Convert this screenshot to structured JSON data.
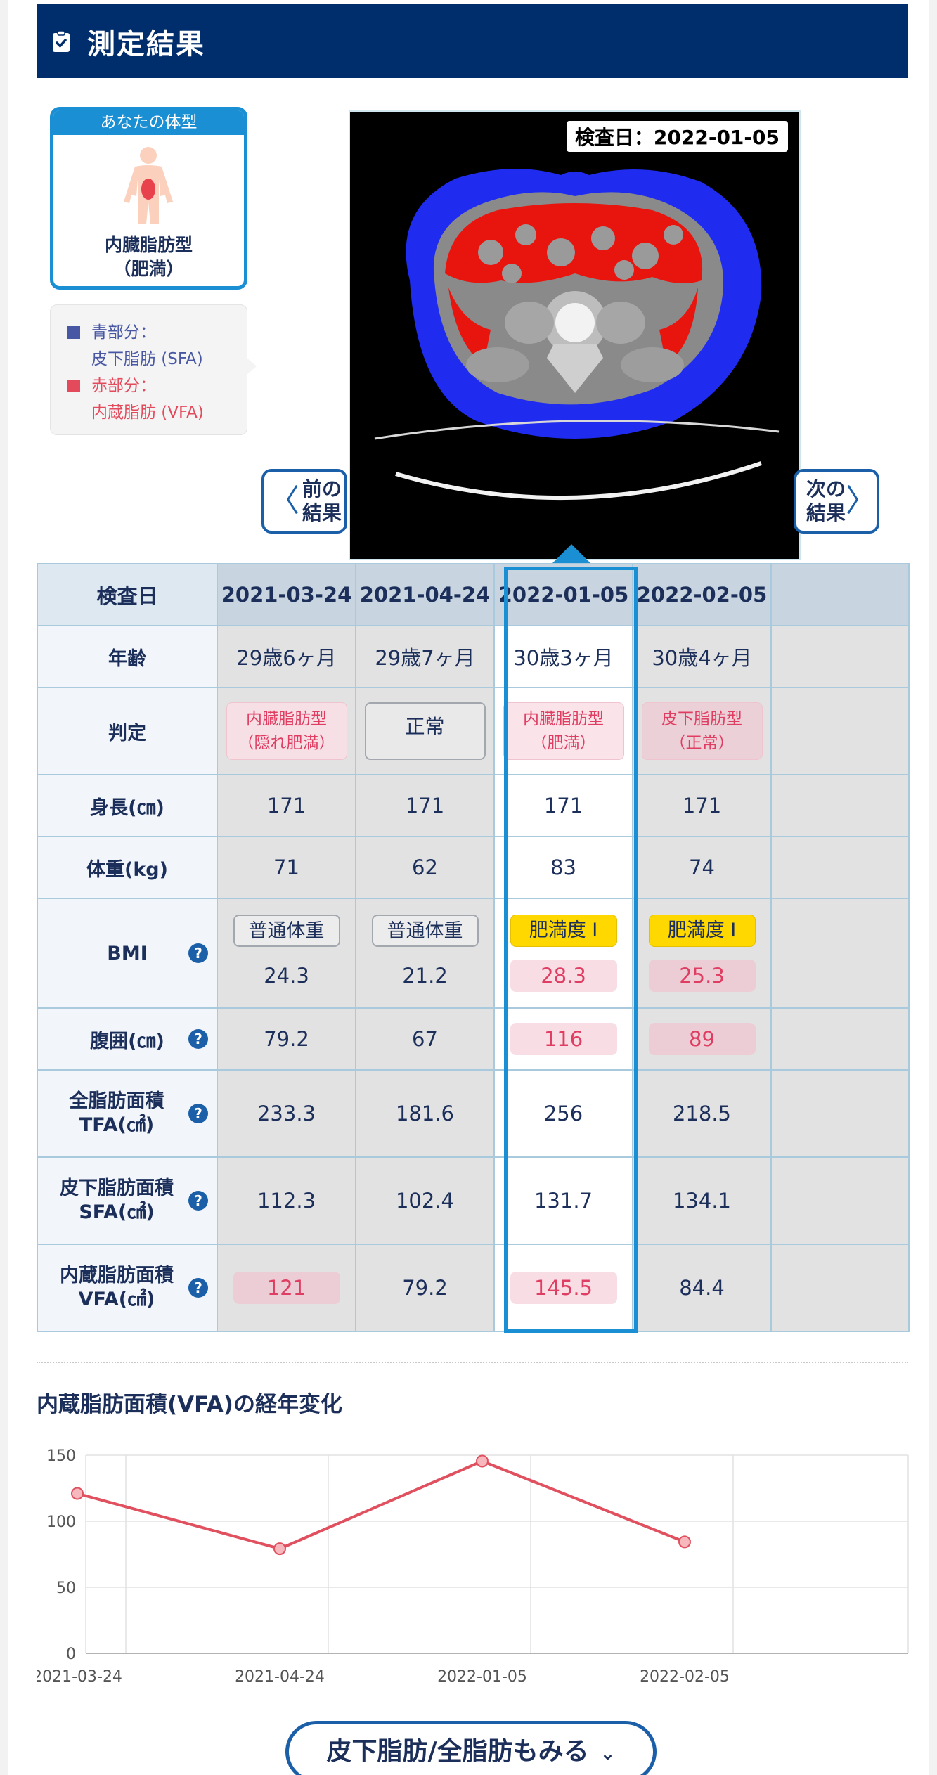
{
  "header": {
    "title": "測定結果",
    "icon": "clipboard-check-icon"
  },
  "body_type": {
    "heading": "あなたの体型",
    "type_line1": "内臓脂肪型",
    "type_line2": "（肥満）",
    "icon": "body-figure-icon"
  },
  "legend": {
    "blue_label": "青部分：",
    "blue_desc": "皮下脂肪 (SFA)",
    "red_label": "赤部分：",
    "red_desc": "内蔵脂肪 (VFA)",
    "blue_color": "#4757a3",
    "red_color": "#e34a5c"
  },
  "ct": {
    "date_label": "検査日：2022-01-05"
  },
  "nav": {
    "prev_line1": "前の",
    "prev_line2": "結果",
    "next_line1": "次の",
    "next_line2": "結果"
  },
  "table": {
    "row_headers": {
      "date": "検査日",
      "age": "年齢",
      "judgement": "判定",
      "height": "身長(㎝)",
      "weight": "体重(kg)",
      "bmi": "BMI",
      "waist": "腹囲(㎝)",
      "tfa1": "全脂肪面積",
      "tfa2": "TFA(㎠)",
      "sfa1": "皮下脂肪面積",
      "sfa2": "SFA(㎠)",
      "vfa1": "内蔵脂肪面積",
      "vfa2": "VFA(㎠)",
      "help": "?"
    },
    "columns": [
      {
        "date": "2021-03-24",
        "age": "29歳6ヶ月",
        "judge1": "内臓脂肪型",
        "judge2": "（隠れ肥満）",
        "height": "171",
        "weight": "71",
        "bmi_class": "普通体重",
        "bmi": "24.3",
        "waist": "79.2",
        "tfa": "233.3",
        "sfa": "112.3",
        "vfa": "121"
      },
      {
        "date": "2021-04-24",
        "age": "29歳7ヶ月",
        "judge1": "正常",
        "judge2": "",
        "height": "171",
        "weight": "62",
        "bmi_class": "普通体重",
        "bmi": "21.2",
        "waist": "67",
        "tfa": "181.6",
        "sfa": "102.4",
        "vfa": "79.2"
      },
      {
        "date": "2022-01-05",
        "age": "30歳3ヶ月",
        "judge1": "内臓脂肪型",
        "judge2": "（肥満）",
        "height": "171",
        "weight": "83",
        "bmi_class": "肥満度 Ⅰ",
        "bmi": "28.3",
        "waist": "116",
        "tfa": "256",
        "sfa": "131.7",
        "vfa": "145.5"
      },
      {
        "date": "2022-02-05",
        "age": "30歳4ヶ月",
        "judge1": "皮下脂肪型",
        "judge2": "（正常）",
        "height": "171",
        "weight": "74",
        "bmi_class": "肥満度 Ⅰ",
        "bmi": "25.3",
        "waist": "89",
        "tfa": "218.5",
        "sfa": "134.1",
        "vfa": "84.4"
      }
    ]
  },
  "chart_title": "内蔵脂肪面積(VFA)の経年変化",
  "chart_data": {
    "type": "line",
    "title": "内蔵脂肪面積(VFA)の経年変化",
    "categories": [
      "2021-03-24",
      "2021-04-24",
      "2022-01-05",
      "2022-02-05"
    ],
    "series": [
      {
        "values": [
          121,
          79.2,
          145.5,
          84.4
        ],
        "color": "#e0505f"
      }
    ],
    "ylim": [
      0,
      150
    ],
    "yticks": [
      0,
      50,
      100,
      150
    ],
    "grid": true,
    "xlabel": "",
    "ylabel": ""
  },
  "more_button": {
    "label": "皮下脂肪/全脂肪もみる",
    "icon": "chevron-down-icon"
  }
}
